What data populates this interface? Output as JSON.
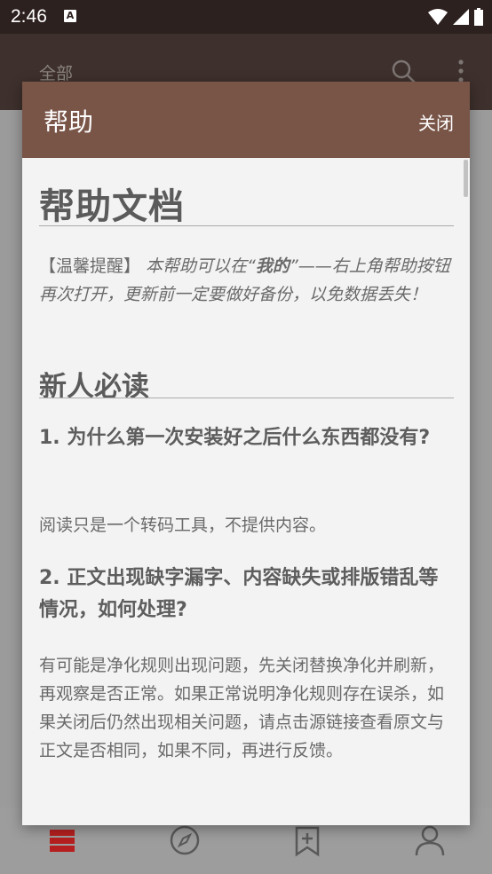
{
  "status": {
    "time": "2:46"
  },
  "appbar": {
    "title": "全部"
  },
  "dialog": {
    "title": "帮助",
    "close_label": "关闭",
    "doc": {
      "h1": "帮助文档",
      "notice_prefix": "【温馨提醒】",
      "notice_part1": " 本帮助可以在“",
      "notice_bold": "我的",
      "notice_part2": "”——右上角帮助按钮再次打开，更新前一定要做好备份，以免数据丢失！",
      "h2": "新人必读",
      "q1": "1. 为什么第一次安装好之后什么东西都没有?",
      "a1": "阅读只是一个转码工具，不提供内容。",
      "q2": "2. 正文出现缺字漏字、内容缺失或排版错乱等情况，如何处理?",
      "a2": "有可能是净化规则出现问题，先关闭替换净化并刷新，再观察是否正常。如果正常说明净化规则存在误杀，如果关闭后仍然出现相关问题，请点击源链接查看原文与正文是否相同，如果不同，再进行反馈。"
    }
  },
  "bottom_nav": {
    "icons": [
      "bookshelf-icon",
      "explore-icon",
      "rss-icon",
      "profile-icon"
    ]
  },
  "colors": {
    "header": "#795548",
    "status_bar": "#2d211f",
    "accent": "#c62828"
  }
}
